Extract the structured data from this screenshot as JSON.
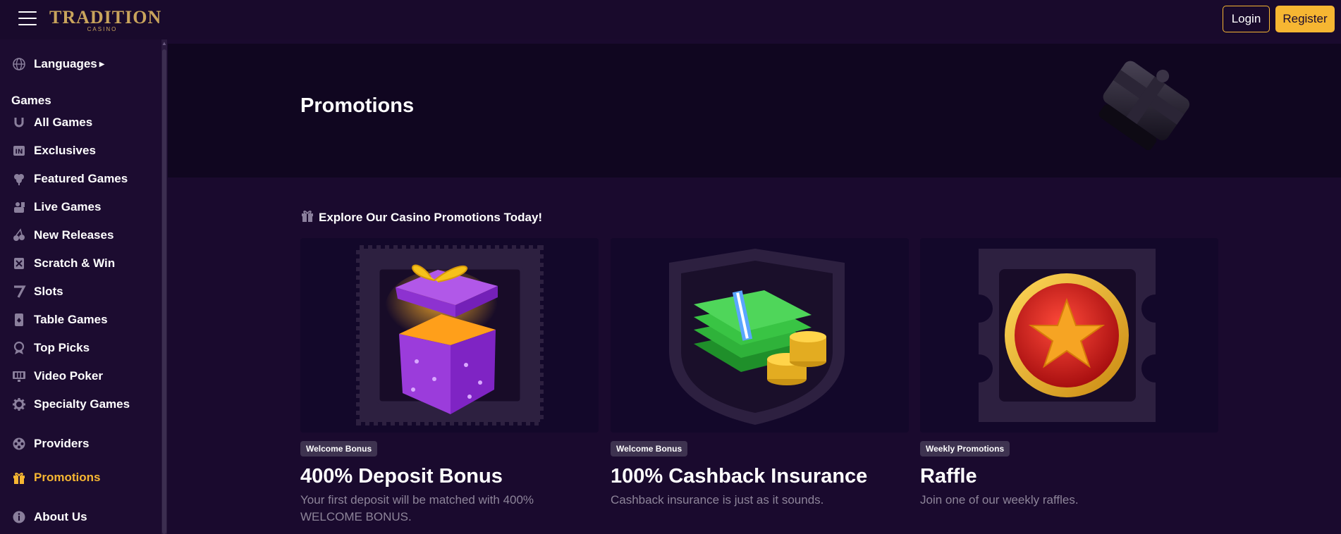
{
  "header": {
    "logo_text": "TRADITION",
    "logo_sub": "CASINO",
    "login_label": "Login",
    "register_label": "Register"
  },
  "sidebar": {
    "languages_label": "Languages",
    "games_heading": "Games",
    "items": [
      {
        "label": "All Games",
        "icon": "horseshoe-icon"
      },
      {
        "label": "Exclusives",
        "icon": "exclusive-icon"
      },
      {
        "label": "Featured Games",
        "icon": "clover-icon"
      },
      {
        "label": "Live Games",
        "icon": "dealer-icon"
      },
      {
        "label": "New Releases",
        "icon": "cherries-icon"
      },
      {
        "label": "Scratch & Win",
        "icon": "scratch-card-icon"
      },
      {
        "label": "Slots",
        "icon": "seven-icon"
      },
      {
        "label": "Table Games",
        "icon": "card-icon"
      },
      {
        "label": "Top Picks",
        "icon": "badge-icon"
      },
      {
        "label": "Video Poker",
        "icon": "monitor-icon"
      },
      {
        "label": "Specialty Games",
        "icon": "gear-icon"
      }
    ],
    "providers_label": "Providers",
    "promotions_label": "Promotions",
    "about_label": "About Us"
  },
  "hero": {
    "title": "Promotions"
  },
  "explore": {
    "label": "Explore Our Casino Promotions Today!"
  },
  "cards": [
    {
      "tag": "Welcome Bonus",
      "title": "400% Deposit Bonus",
      "description": "Your first deposit will be matched with 400% WELCOME BONUS."
    },
    {
      "tag": "Welcome Bonus",
      "title": "100% Cashback Insurance",
      "description": "Cashback insurance is just as it sounds."
    },
    {
      "tag": "Weekly Promotions",
      "title": "Raffle",
      "description": "Join one of our weekly raffles."
    }
  ],
  "colors": {
    "background": "#1a0a2e",
    "accent": "#f6b632",
    "muted_text": "#8d8499"
  }
}
